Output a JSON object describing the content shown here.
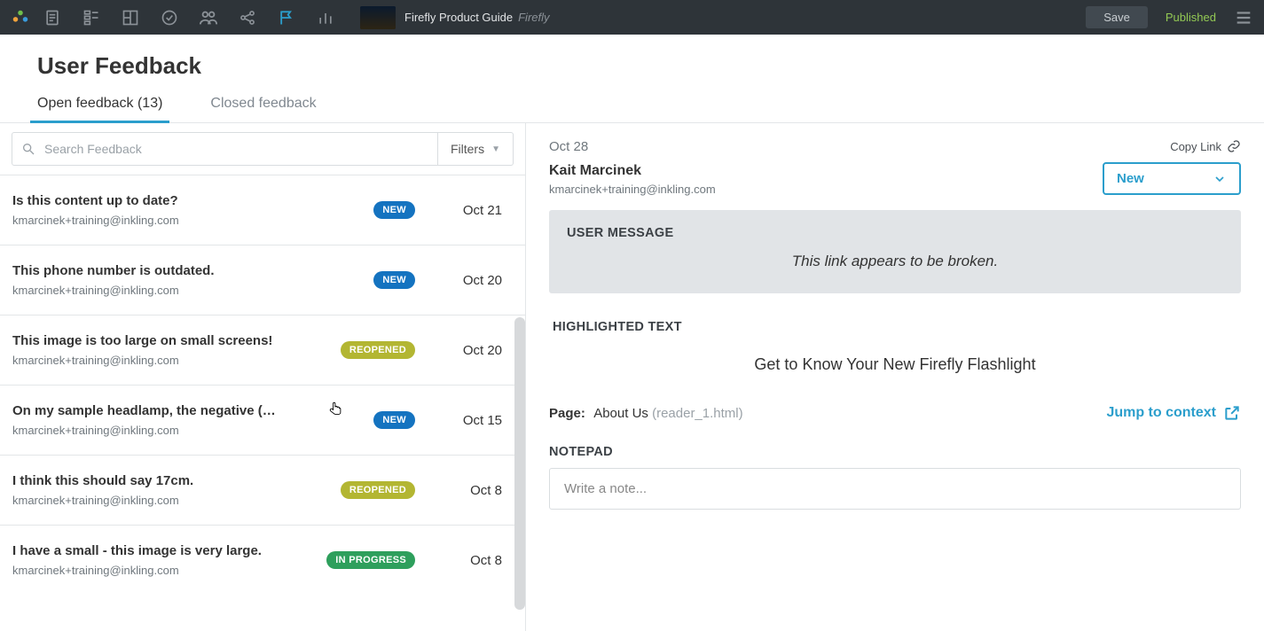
{
  "topbar": {
    "doc_title": "Firefly Product Guide",
    "doc_sub": "Firefly",
    "save_label": "Save",
    "publish_status": "Published"
  },
  "page": {
    "title": "User Feedback",
    "tabs": [
      {
        "label": "Open feedback (13)",
        "active": true
      },
      {
        "label": "Closed feedback",
        "active": false
      }
    ],
    "search_placeholder": "Search Feedback",
    "filters_label": "Filters"
  },
  "feedback": [
    {
      "title": "Is this content up to date?",
      "email": "kmarcinek+training@inkling.com",
      "badge": "NEW",
      "badge_kind": "b-new",
      "date": "Oct 21"
    },
    {
      "title": "This phone number is outdated.",
      "email": "kmarcinek+training@inkling.com",
      "badge": "NEW",
      "badge_kind": "b-new",
      "date": "Oct 20"
    },
    {
      "title": "This image is too large on small screens!",
      "email": "kmarcinek+training@inkling.com",
      "badge": "REOPENED",
      "badge_kind": "b-reopened",
      "date": "Oct 20"
    },
    {
      "title": "On my sample headlamp, the negative (-) …",
      "email": "kmarcinek+training@inkling.com",
      "badge": "NEW",
      "badge_kind": "b-new",
      "date": "Oct 15"
    },
    {
      "title": "I think this should say 17cm.",
      "email": "kmarcinek+training@inkling.com",
      "badge": "REOPENED",
      "badge_kind": "b-reopened",
      "date": "Oct 8"
    },
    {
      "title": "I have a small - this image is very large.",
      "email": "kmarcinek+training@inkling.com",
      "badge": "IN PROGRESS",
      "badge_kind": "b-progress",
      "date": "Oct 8"
    }
  ],
  "detail": {
    "date": "Oct 28",
    "author_name": "Kait Marcinek",
    "author_email": "kmarcinek+training@inkling.com",
    "copy_link_label": "Copy Link",
    "status_value": "New",
    "user_message_label": "USER MESSAGE",
    "user_message_text": "This link appears to be broken.",
    "highlighted_label": "HIGHLIGHTED TEXT",
    "highlighted_text": "Get to Know Your New Firefly Flashlight",
    "page_label": "Page:",
    "page_name": "About Us",
    "page_file": "(reader_1.html)",
    "jump_label": "Jump to context",
    "notepad_label": "NOTEPAD",
    "notepad_placeholder": "Write a note..."
  }
}
